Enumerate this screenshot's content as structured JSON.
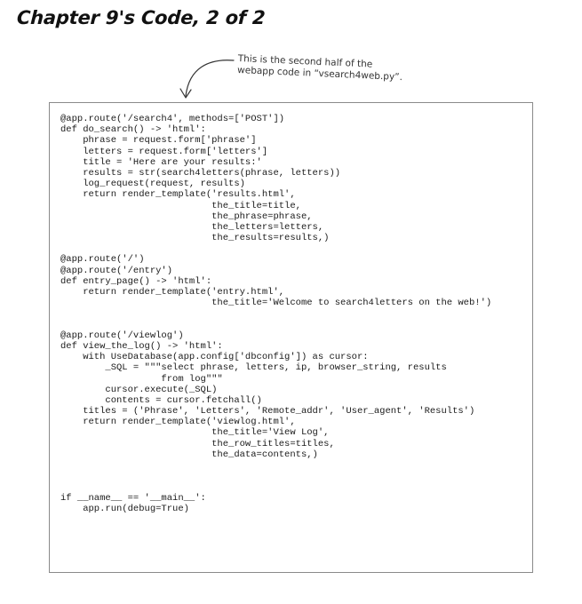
{
  "page": {
    "heading": "Chapter 9's Code, 2 of 2"
  },
  "annotation": {
    "lines": [
      "This is the second half of the",
      "webapp code in “vsearch4web.py”."
    ]
  },
  "code": {
    "lines": [
      "@app.route('/search4', methods=['POST'])",
      "def do_search() -> 'html':",
      "    phrase = request.form['phrase']",
      "    letters = request.form['letters']",
      "    title = 'Here are your results:'",
      "    results = str(search4letters(phrase, letters))",
      "    log_request(request, results)",
      "    return render_template('results.html',",
      "                           the_title=title,",
      "                           the_phrase=phrase,",
      "                           the_letters=letters,",
      "                           the_results=results,)",
      "",
      "@app.route('/')",
      "@app.route('/entry')",
      "def entry_page() -> 'html':",
      "    return render_template('entry.html',",
      "                           the_title='Welcome to search4letters on the web!')",
      "",
      "",
      "@app.route('/viewlog')",
      "def view_the_log() -> 'html':",
      "    with UseDatabase(app.config['dbconfig']) as cursor:",
      "        _SQL = \"\"\"select phrase, letters, ip, browser_string, results",
      "                  from log\"\"\"",
      "        cursor.execute(_SQL)",
      "        contents = cursor.fetchall()",
      "    titles = ('Phrase', 'Letters', 'Remote_addr', 'User_agent', 'Results')",
      "    return render_template('viewlog.html',",
      "                           the_title='View Log',",
      "                           the_row_titles=titles,",
      "                           the_data=contents,)",
      "",
      "",
      "",
      "if __name__ == '__main__':",
      "    app.run(debug=True)"
    ]
  }
}
